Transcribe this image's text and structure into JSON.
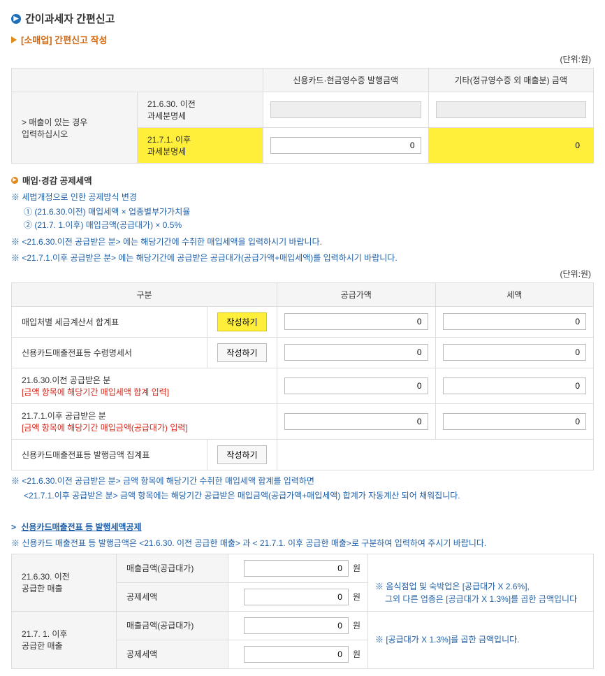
{
  "header": {
    "main_title": "간이과세자 간편신고",
    "sub_title": "[소매업] 간편신고 작성",
    "unit_label": "(단위:원)"
  },
  "sales": {
    "col_card": "신용카드·현금영수증 발행금액",
    "col_other": "기타(정규영수증 외 매출분) 금액",
    "row_head_line1": "> 매출이 있는 경우",
    "row_head_line2": "입력하십시오",
    "before_line1": "21.6.30. 이전",
    "before_line2": "과세분명세",
    "after_line1": "21.7.1. 이후",
    "after_line2": "과세분명세",
    "after_card_val": "0",
    "after_other_val": "0"
  },
  "purchase": {
    "section_title": "매입·경감 공제세액",
    "note1": "※ 세법개정으로 인한 공제방식 변경",
    "note1a": "① (21.6.30.이전) 매입세액 × 업종별부가가치율",
    "note1b": "② (21.7. 1.이후) 매입금액(공급대가) × 0.5%",
    "note2": "※ <21.6.30.이전 공급받은 분> 에는 해당기간에 수취한 매입세액을 입력하시기 바랍니다.",
    "note3": "※ <21.7.1.이후 공급받은 분> 에는 해당기간에 공급받은 공급대가(공급가액+매입세액)를 입력하시기 바랍니다.",
    "col_div": "구분",
    "col_supply": "공급가액",
    "col_tax": "세액",
    "row1": "매입처별 세금계산서 합계표",
    "row2": "신용카드매출전표등 수령명세서",
    "row3_l1": "21.6.30.이전 공급받은 분",
    "row3_l2": "[금액 항목에 해당기간 매입세액 합계 입력]",
    "row4_l1": "21.7.1.이후 공급받은 분",
    "row4_l2": "[금액 항목에 해당기간 매입금액(공급대가) 입력]",
    "row5": "신용카드매출전표등 발행금액 집계표",
    "btn_write": "작성하기",
    "v0": "0",
    "footnote_l1": "※ <21.6.30.이전 공급받은 분> 금액 항목에 해당기간 수취한 매입세액 합계를 입력하면",
    "footnote_l2": "<21.7.1.이후 공급받은 분> 금액 항목에는 해당기간 공급받은 매입금액(공급가액+매입세액) 합계가 자동계산 되어 채워집니다."
  },
  "credit": {
    "link_title": "신용카드매출전표 등 발행세액공제",
    "note": "※ 신용카드 매출전표 등 발행금액은 <21.6.30. 이전 공급한 매출> 과 < 21.7.1. 이후 공급한 매출>로 구분하여 입력하여 주시기 바랍니다.",
    "before_head_l1": "21.6.30. 이전",
    "before_head_l2": "공급한 매출",
    "after_head_l1": "21.7. 1. 이후",
    "after_head_l2": "공급한 매출",
    "label_amount": "매출금액(공급대가)",
    "label_deduct": "공제세액",
    "won": "원",
    "v0": "0",
    "help_before_l1": "※ 음식점업 및 숙박업은 [공급대가 X 2.6%],",
    "help_before_l2": "그외 다른 업종은 [공급대가 X 1.3%]를 곱한 금액입니다",
    "help_after": "※ [공급대가 X 1.3%]를 곱한 금액입니다."
  }
}
